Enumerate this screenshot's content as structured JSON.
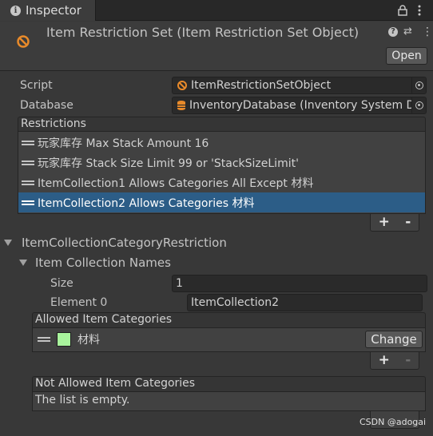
{
  "tab": {
    "label": "Inspector"
  },
  "header": {
    "title": "Item Restriction Set (Item Restriction Set Object)",
    "open_label": "Open"
  },
  "script": {
    "label": "Script",
    "value": "ItemRestrictionSetObject"
  },
  "database": {
    "label": "Database",
    "value": "InventoryDatabase (Inventory System D"
  },
  "restrictions": {
    "header": "Restrictions",
    "items": [
      {
        "label": "玩家库存  Max Stack Amount 16"
      },
      {
        "label": "玩家库存 Stack Size Limit 99 or 'StackSizeLimit'"
      },
      {
        "label": "ItemCollection1  Allows Categories All Except 材料"
      },
      {
        "label": "ItemCollection2  Allows Categories 材料",
        "selected": true
      }
    ],
    "add": "+",
    "remove": "-"
  },
  "category_restriction": {
    "title": "ItemCollectionCategoryRestriction",
    "names_foldout": "Item Collection Names",
    "size_label": "Size",
    "size_value": "1",
    "element0_label": "Element 0",
    "element0_value": "ItemCollection2",
    "allowed": {
      "header": "Allowed Item Categories",
      "items": [
        {
          "label": "材料",
          "color": "#a9f49d"
        }
      ],
      "change_label": "Change",
      "add": "+",
      "remove": "-"
    },
    "not_allowed": {
      "header": "Not Allowed Item Categories",
      "empty_text": "The list is empty."
    }
  },
  "watermark": "CSDN @adogai",
  "colors": {
    "selected_row": "#2c5d87",
    "panel": "#383838",
    "accent_icon": "#e88a2a"
  }
}
